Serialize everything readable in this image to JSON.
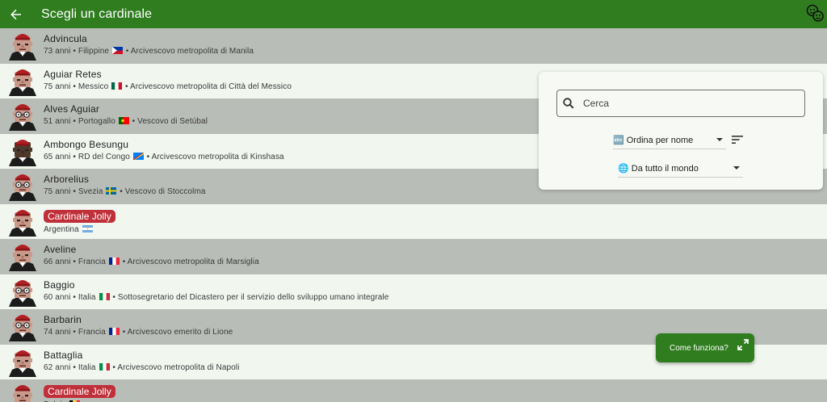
{
  "appbar": {
    "title": "Scegli un cardinale"
  },
  "rows": [
    {
      "name": "Advincula",
      "age": "73 anni",
      "country": "Filippine",
      "role": "Arcivescovo metropolita di Manila",
      "flag": "ph",
      "face": "light",
      "glasses": false,
      "special": false
    },
    {
      "name": "Aguiar Retes",
      "age": "75 anni",
      "country": "Messico",
      "role": "Arcivescovo metropolita di Città del Messico",
      "flag": "mx",
      "face": "light",
      "glasses": false,
      "special": false
    },
    {
      "name": "Alves Aguiar",
      "age": "51 anni",
      "country": "Portogallo",
      "role": "Vescovo di Setúbal",
      "flag": "pt",
      "face": "light",
      "glasses": true,
      "special": false
    },
    {
      "name": "Ambongo Besungu",
      "age": "65 anni",
      "country": "RD del Congo",
      "role": "Arcivescovo metropolita di Kinshasa",
      "flag": "cd",
      "face": "dark",
      "glasses": false,
      "special": false
    },
    {
      "name": "Arborelius",
      "age": "75 anni",
      "country": "Svezia",
      "role": "Vescovo di Stoccolma",
      "flag": "se",
      "face": "light",
      "glasses": true,
      "special": false
    },
    {
      "name": "Cardinale Jolly",
      "country": "Argentina",
      "flag": "ar",
      "face": "light",
      "glasses": false,
      "special": true
    },
    {
      "name": "Aveline",
      "age": "66 anni",
      "country": "Francia",
      "role": "Arcivescovo metropolita di Marsiglia",
      "flag": "fr",
      "face": "light",
      "glasses": false,
      "special": false
    },
    {
      "name": "Baggio",
      "age": "60 anni",
      "country": "Italia",
      "role": "Sottosegretario del Dicastero per il servizio dello sviluppo umano integrale",
      "flag": "it",
      "face": "light",
      "glasses": true,
      "special": false
    },
    {
      "name": "Barbarin",
      "age": "74 anni",
      "country": "Francia",
      "role": "Arcivescovo emerito di Lione",
      "flag": "fr",
      "face": "light",
      "glasses": true,
      "special": false
    },
    {
      "name": "Battaglia",
      "age": "62 anni",
      "country": "Italia",
      "role": "Arcivescovo metropolita di Napoli",
      "flag": "it",
      "face": "light",
      "glasses": false,
      "special": false
    },
    {
      "name": "Cardinale Jolly",
      "country": "Belgio",
      "flag": "be",
      "face": "light",
      "glasses": false,
      "special": true
    }
  ],
  "panel": {
    "search_placeholder": "Cerca",
    "sort_label": "🔤 Ordina per nome",
    "region_label": "🌐 Da tutto il mondo"
  },
  "fab": {
    "label": "Come funziona?"
  },
  "colors": {
    "primary": "#2f7d1f",
    "row_dark": "#b9bdb7",
    "row_light": "#f1f6ef",
    "badge": "#c0303a"
  }
}
